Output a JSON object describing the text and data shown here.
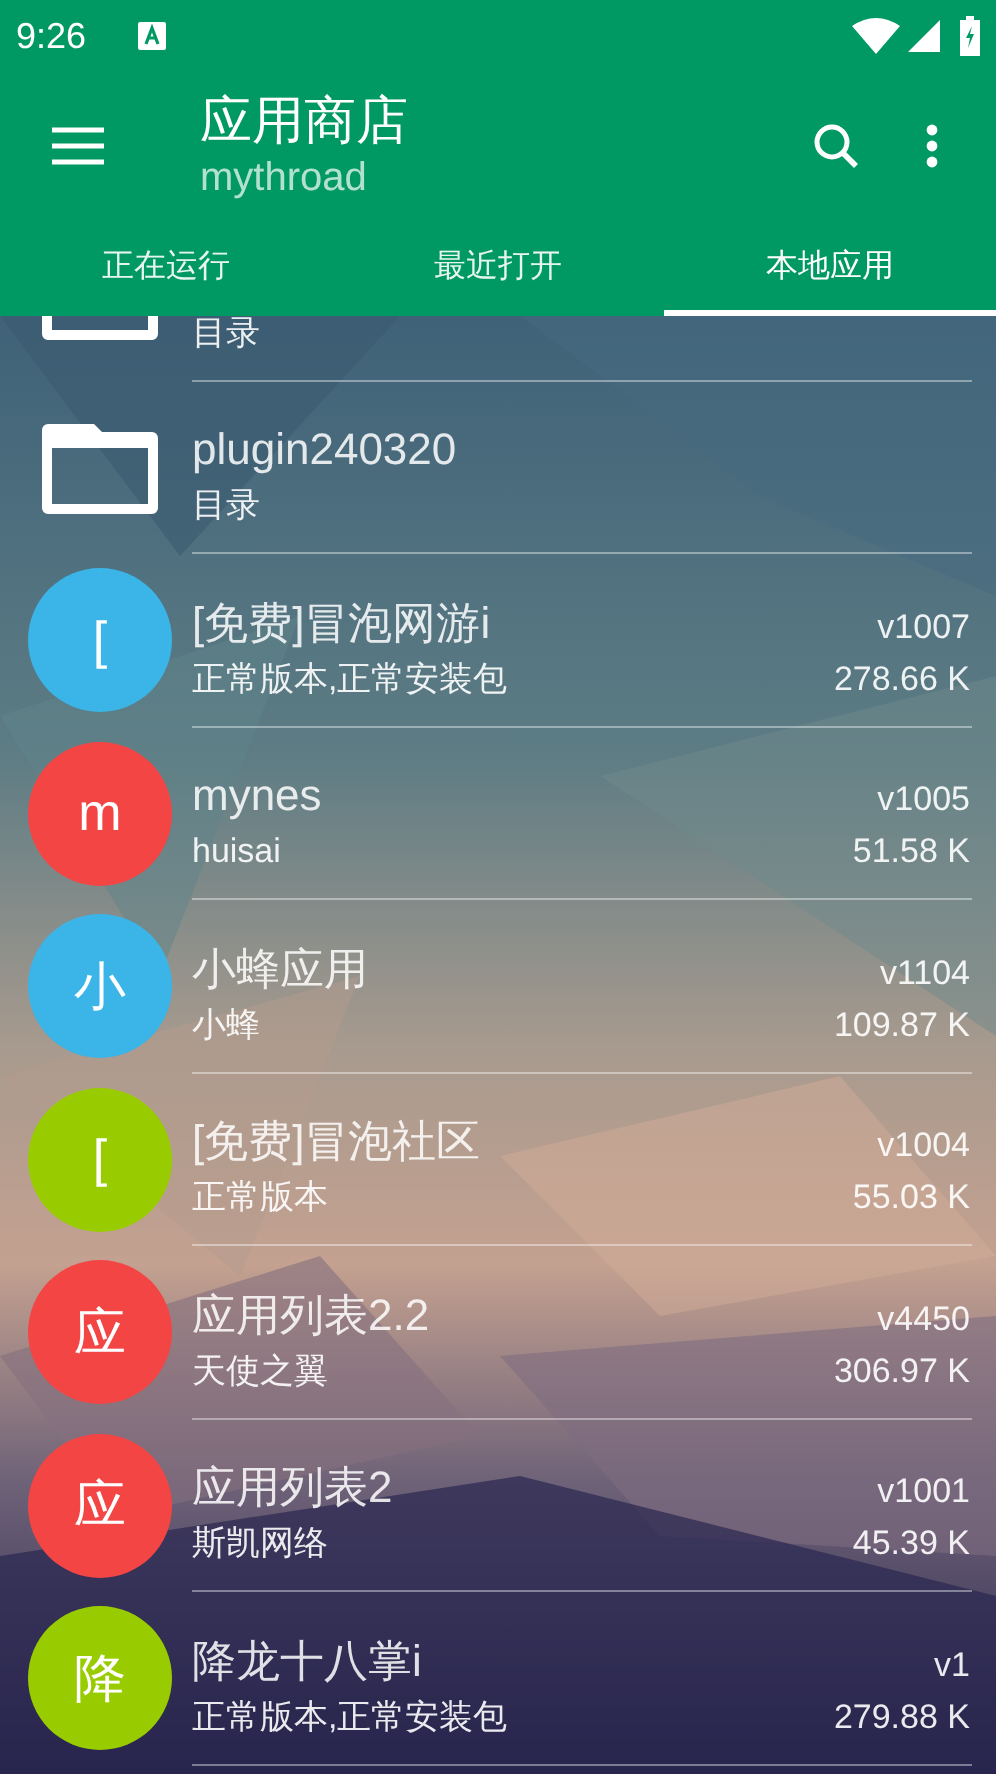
{
  "status_bar": {
    "time": "9:26"
  },
  "toolbar": {
    "title": "应用商店",
    "subtitle": "mythroad"
  },
  "tabs": [
    {
      "label": "正在运行",
      "selected": false
    },
    {
      "label": "最近打开",
      "selected": false
    },
    {
      "label": "本地应用",
      "selected": true
    }
  ],
  "list": [
    {
      "kind": "folder",
      "subtitle": "目录"
    },
    {
      "kind": "folder",
      "title": "plugin240320",
      "subtitle": "目录"
    },
    {
      "kind": "app",
      "avatar": "[",
      "color": "#3bb4e8",
      "title": "[免费]冒泡网游i",
      "version": "v1007",
      "subtitle": "正常版本,正常安装包",
      "size": "278.66 K"
    },
    {
      "kind": "app",
      "avatar": "m",
      "color": "#f44545",
      "title": "mynes",
      "version": "v1005",
      "subtitle": "huisai",
      "size": "51.58 K"
    },
    {
      "kind": "app",
      "avatar": "小",
      "color": "#3bb4e8",
      "title": "小蜂应用",
      "version": "v1104",
      "subtitle": "小蜂",
      "size": "109.87 K"
    },
    {
      "kind": "app",
      "avatar": "[",
      "color": "#99cc00",
      "title": "[免费]冒泡社区",
      "version": "v1004",
      "subtitle": "正常版本",
      "size": "55.03 K"
    },
    {
      "kind": "app",
      "avatar": "应",
      "color": "#f44545",
      "title": "应用列表2.2",
      "version": "v4450",
      "subtitle": "天使之翼",
      "size": "306.97 K"
    },
    {
      "kind": "app",
      "avatar": "应",
      "color": "#f44545",
      "title": "应用列表2",
      "version": "v1001",
      "subtitle": "斯凯网络",
      "size": "45.39 K"
    },
    {
      "kind": "app",
      "avatar": "降",
      "color": "#99cc00",
      "title": "降龙十八掌i",
      "version": "v1",
      "subtitle": "正常版本,正常安装包",
      "size": "279.88 K"
    }
  ]
}
